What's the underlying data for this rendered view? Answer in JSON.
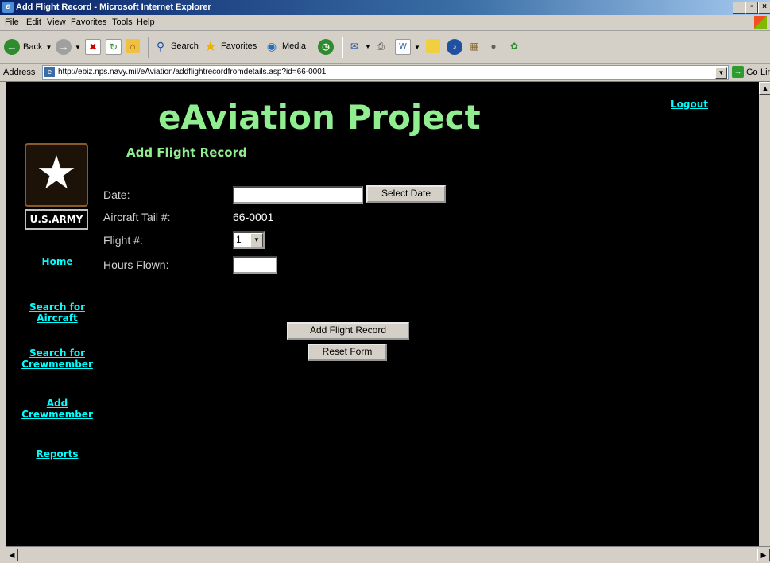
{
  "window": {
    "title": "Add Flight Record - Microsoft Internet Explorer",
    "controls": {
      "minimize": "_",
      "maximize": "̱□",
      "close": "×"
    }
  },
  "menu": [
    "File",
    "Edit",
    "View",
    "Favorites",
    "Tools",
    "Help"
  ],
  "toolbar": {
    "back": "Back",
    "search": "Search",
    "favorites": "Favorites",
    "media": "Media"
  },
  "address": {
    "label": "Address",
    "url": "http://ebiz.nps.navy.mil/eAviation/addflightrecordfromdetails.asp?id=66-0001",
    "go": "Go",
    "links": "Links"
  },
  "page": {
    "title": "eAviation Project",
    "logout": "Logout",
    "subtitle": "Add Flight Record",
    "logo_text": "U.S.ARMY",
    "nav": [
      {
        "label": "Home"
      },
      {
        "label": "Search for Aircraft"
      },
      {
        "label": "Search for Crewmember"
      },
      {
        "label": "Add Crewmember"
      },
      {
        "label": "Reports"
      }
    ],
    "form": {
      "date_label": "Date:",
      "date_value": "",
      "select_date_button": "Select Date",
      "tail_label": "Aircraft Tail #:",
      "tail_value": "66-0001",
      "flight_label": "Flight #:",
      "flight_value": "1",
      "hours_label": "Hours Flown:",
      "hours_value": "",
      "add_button": "Add Flight Record",
      "reset_button": "Reset Form"
    }
  }
}
